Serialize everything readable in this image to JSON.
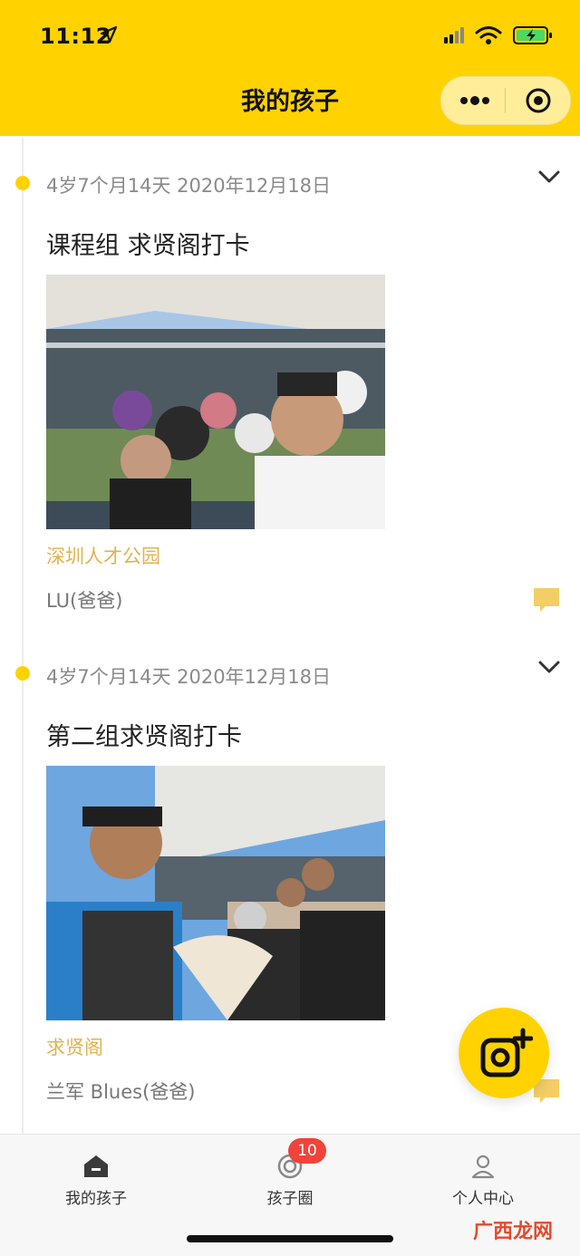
{
  "status_bar": {
    "time": "11:12"
  },
  "header": {
    "title": "我的孩子"
  },
  "colors": {
    "brand": "#FFD200",
    "location": "#E0B350",
    "badge": "#F0433A"
  },
  "entries": [
    {
      "age_date": "4岁7个月14天 2020年12月18日",
      "title": "课程组 求贤阁打卡",
      "photo_alt": "合影照片",
      "location": "深圳人才公园",
      "author": "LU(爸爸)"
    },
    {
      "age_date": "4岁7个月14天 2020年12月18日",
      "title": "第二组求贤阁打卡",
      "photo_alt": "合影照片",
      "location": "求贤阁",
      "author": "兰军 Blues(爸爸)"
    }
  ],
  "tabbar": {
    "tabs": [
      {
        "label": "我的孩子",
        "icon": "home-icon"
      },
      {
        "label": "孩子圈",
        "icon": "circle-icon",
        "badge": "10"
      },
      {
        "label": "个人中心",
        "icon": "person-icon"
      }
    ]
  },
  "watermark": "广西龙网"
}
